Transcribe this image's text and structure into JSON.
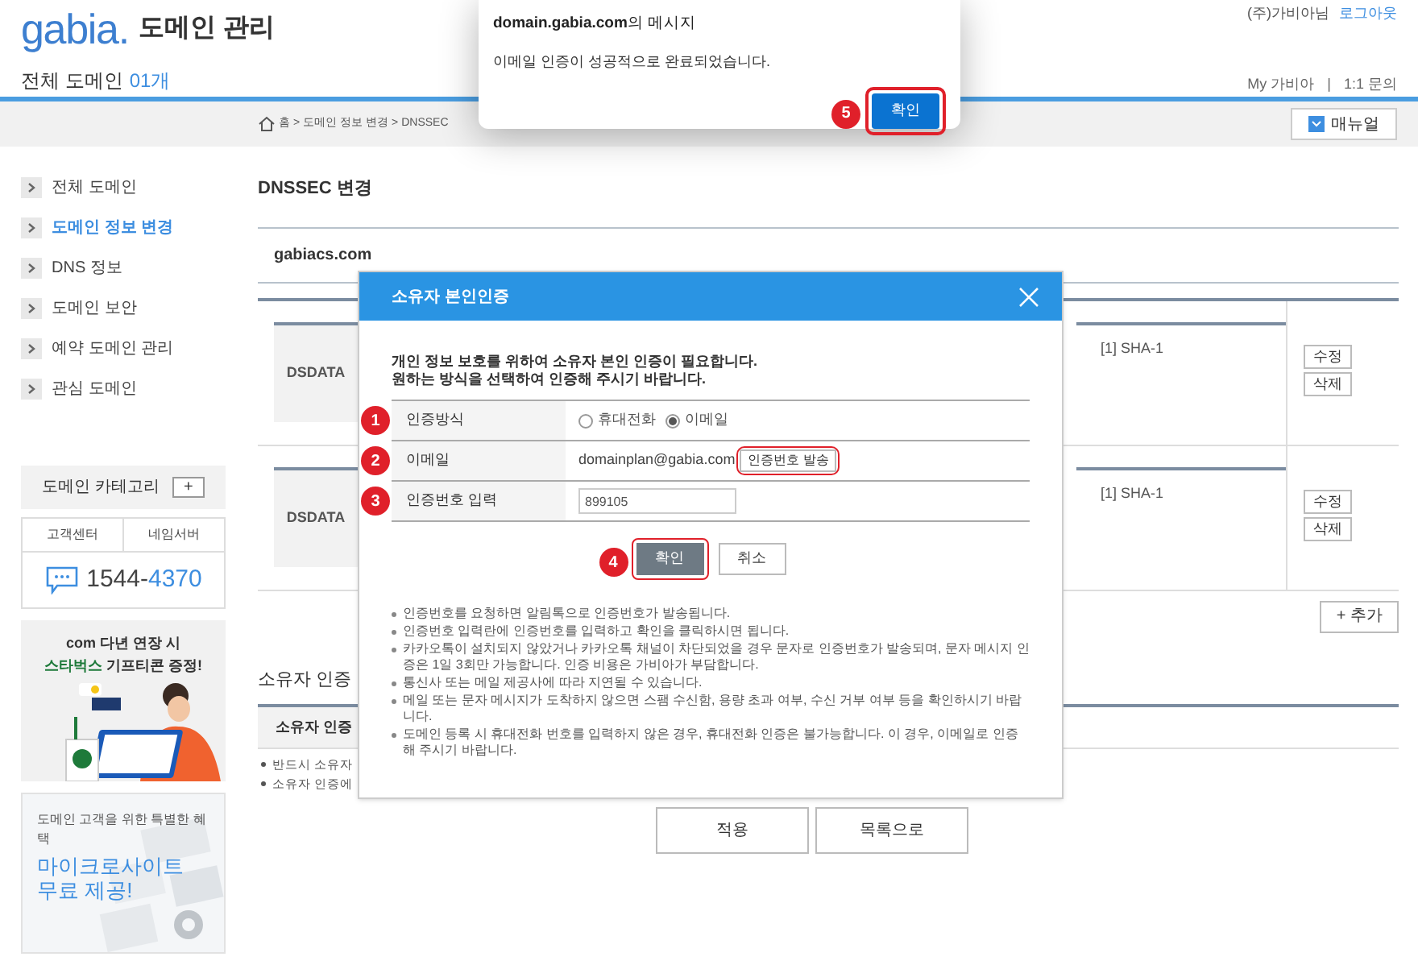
{
  "header": {
    "logo": "gabia.",
    "title": "도메인 관리",
    "user": "(주)가비아님",
    "logout": "로그아웃",
    "count_label": "전체 도메인",
    "count": "01개",
    "links": [
      "My 가비아",
      "1:1 문의"
    ],
    "link_separator": "|"
  },
  "breadcrumb": {
    "items": [
      "홈",
      "도메인 정보 변경",
      "DNSSEC"
    ],
    "separator": ">"
  },
  "manual_button": "매뉴얼",
  "sidebar": {
    "items": [
      {
        "label": "전체 도메인",
        "selected": false
      },
      {
        "label": "도메인 정보 변경",
        "selected": true
      },
      {
        "label": "DNS 정보",
        "selected": false
      },
      {
        "label": "도메인 보안",
        "selected": false
      },
      {
        "label": "예약 도메인 관리",
        "selected": false
      },
      {
        "label": "관심 도메인",
        "selected": false
      }
    ],
    "category": {
      "label": "도메인 카테고리",
      "button": "+"
    },
    "support": {
      "tabs": [
        "고객센터",
        "네임서버"
      ],
      "phone_main": "1544-",
      "phone_accent": "4370"
    },
    "promo": {
      "line": "com 다년 연장 시",
      "highlight": "스타벅스",
      "rest": " 기프티콘 증정!"
    },
    "microsite": {
      "caption": "도메인 고객을 위한 특별한 혜택",
      "headline": [
        "마이크로사이트",
        "무료 제공!"
      ]
    }
  },
  "content": {
    "title": "DNSSEC 변경",
    "domain": "gabiacs.com",
    "records": [
      {
        "label": "DSDATA",
        "digest": "[1] SHA-1",
        "actions": [
          "수정",
          "삭제"
        ]
      },
      {
        "label": "DSDATA",
        "digest": "[1] SHA-1",
        "actions": [
          "수정",
          "삭제"
        ]
      }
    ],
    "add_button": "+ 추가",
    "owner": {
      "title": "소유자 인증",
      "header": "소유자 인증",
      "notes": [
        "반드시 소유자",
        "소유자 인증에"
      ]
    },
    "buttons": [
      "적용",
      "목록으로"
    ]
  },
  "modal": {
    "title": "소유자 본인인증",
    "intro": [
      "개인 정보 보호를 위하여 소유자 본인 인증이 필요합니다.",
      "원하는 방식을 선택하여 인증해 주시기 바랍니다."
    ],
    "rows": [
      {
        "kind": "radio",
        "label": "인증방식",
        "step": "1",
        "options": [
          {
            "label": "휴대전화",
            "selected": false
          },
          {
            "label": "이메일",
            "selected": true
          }
        ]
      },
      {
        "kind": "email",
        "label": "이메일",
        "step": "2",
        "value": "domainplan@gabia.com",
        "button": "인증번호 발송",
        "highlighted": true
      },
      {
        "kind": "input",
        "label": "인증번호 입력",
        "step": "3",
        "value": "899105"
      }
    ],
    "buttons": [
      {
        "label": "확인",
        "kind": "primary",
        "step": "4",
        "highlighted": true
      },
      {
        "label": "취소",
        "kind": "secondary",
        "highlighted": false
      }
    ],
    "notes": [
      "인증번호를 요청하면 알림톡으로 인증번호가 발송됩니다.",
      "인증번호 입력란에 인증번호를 입력하고 확인을 클릭하시면 됩니다.",
      "카카오톡이 설치되지 않았거나 카카오톡 채널이 차단되었을 경우 문자로 인증번호가 발송되며, 문자 메시지 인증은 1일 3회만 가능합니다. 인증 비용은 가비아가 부담합니다.",
      "통신사 또는 메일 제공사에 따라 지연될 수 있습니다.",
      "메일 또는 문자 메시지가 도착하지 않으면 스팸 수신함, 용량 초과 여부, 수신 거부 여부 등을 확인하시기 바랍니다.",
      "도메인 등록 시 휴대전화 번호를 입력하지 않은 경우, 휴대전화 인증은 불가능합니다. 이 경우, 이메일로 인증해 주시기 바랍니다."
    ]
  },
  "alert": {
    "title": "**domain.gabia.com**의 메시지",
    "message": "이메일 인증이 성공적으로 완료되었습니다.",
    "button": "확인",
    "step": "5",
    "highlighted": true
  }
}
